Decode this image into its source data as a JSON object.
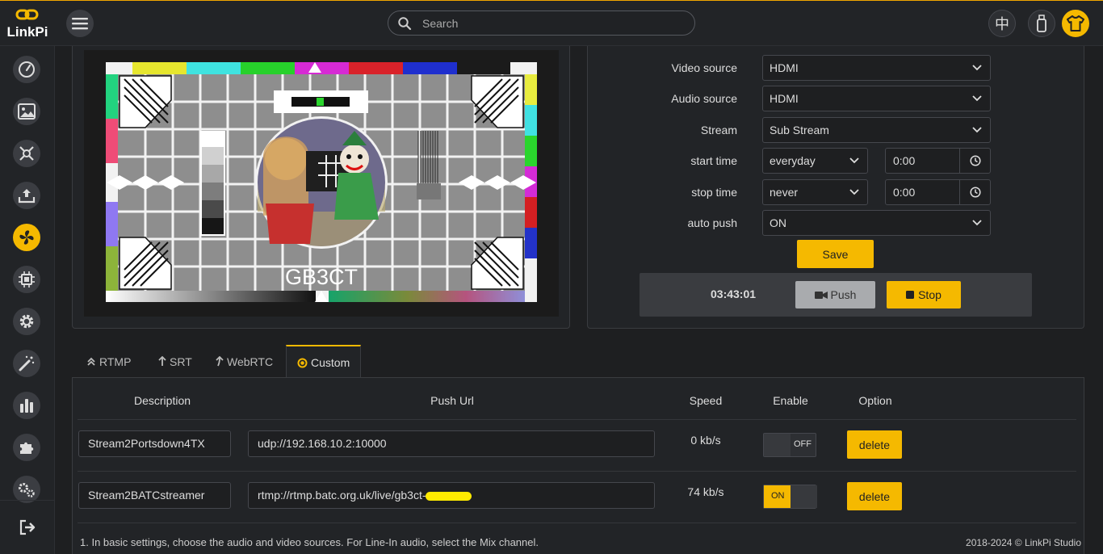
{
  "brand": {
    "name": "LinkPi",
    "glyph": "∞"
  },
  "search": {
    "placeholder": "Search"
  },
  "header": {
    "lang_label": "中"
  },
  "colors": {
    "accent": "#f5b900",
    "background": "#1e1f21",
    "panel": "#222427"
  },
  "sidebar": {
    "items": [
      {
        "icon": "dashboard-gauge-icon"
      },
      {
        "icon": "image-icon"
      },
      {
        "icon": "network-hub-icon"
      },
      {
        "icon": "upload-icon"
      },
      {
        "icon": "stream-push-icon",
        "active": true
      },
      {
        "icon": "chip-icon"
      },
      {
        "icon": "gear-icon"
      },
      {
        "icon": "magic-wand-icon"
      },
      {
        "icon": "bar-chart-icon"
      },
      {
        "icon": "puzzle-icon"
      },
      {
        "icon": "gears-icon"
      }
    ],
    "logout_icon": "logout-icon"
  },
  "preview": {
    "test_card_caption": "GB3CT"
  },
  "settings": {
    "video_source": {
      "label": "Video source",
      "value": "HDMI"
    },
    "audio_source": {
      "label": "Audio source",
      "value": "HDMI"
    },
    "stream": {
      "label": "Stream",
      "value": "Sub Stream"
    },
    "start_time": {
      "label": "start time",
      "mode": "everyday",
      "time": "0:00"
    },
    "stop_time": {
      "label": "stop time",
      "mode": "never",
      "time": "0:00"
    },
    "auto_push": {
      "label": "auto push",
      "value": "ON"
    },
    "save_label": "Save"
  },
  "push_bar": {
    "elapsed": "03:43:01",
    "push_label": "Push",
    "stop_label": "Stop"
  },
  "tabs": [
    {
      "label": "RTMP",
      "icon": "double-chevron-up-icon"
    },
    {
      "label": "SRT",
      "icon": "arrow-up-icon"
    },
    {
      "label": "WebRTC",
      "icon": "curved-arrow-up-icon"
    },
    {
      "label": "Custom",
      "icon": "radio-dot-icon",
      "active": true
    }
  ],
  "table": {
    "headers": {
      "description": "Description",
      "push_url": "Push Url",
      "speed": "Speed",
      "enable": "Enable",
      "option": "Option"
    },
    "rows": [
      {
        "description": "Stream2Portsdown4TX",
        "url": "udp://192.168.10.2:10000",
        "speed": "0 kb/s",
        "enable": "OFF",
        "option": "delete"
      },
      {
        "description": "Stream2BATCstreamer",
        "url": "rtmp://rtmp.batc.org.uk/live/gb3ct-",
        "speed": "74 kb/s",
        "enable": "ON",
        "option": "delete"
      }
    ]
  },
  "footer": {
    "note": "1. In basic settings, choose the audio and video sources. For Line-In audio, select the Mix channel.",
    "copyright": "2018-2024 © LinkPi Studio"
  }
}
